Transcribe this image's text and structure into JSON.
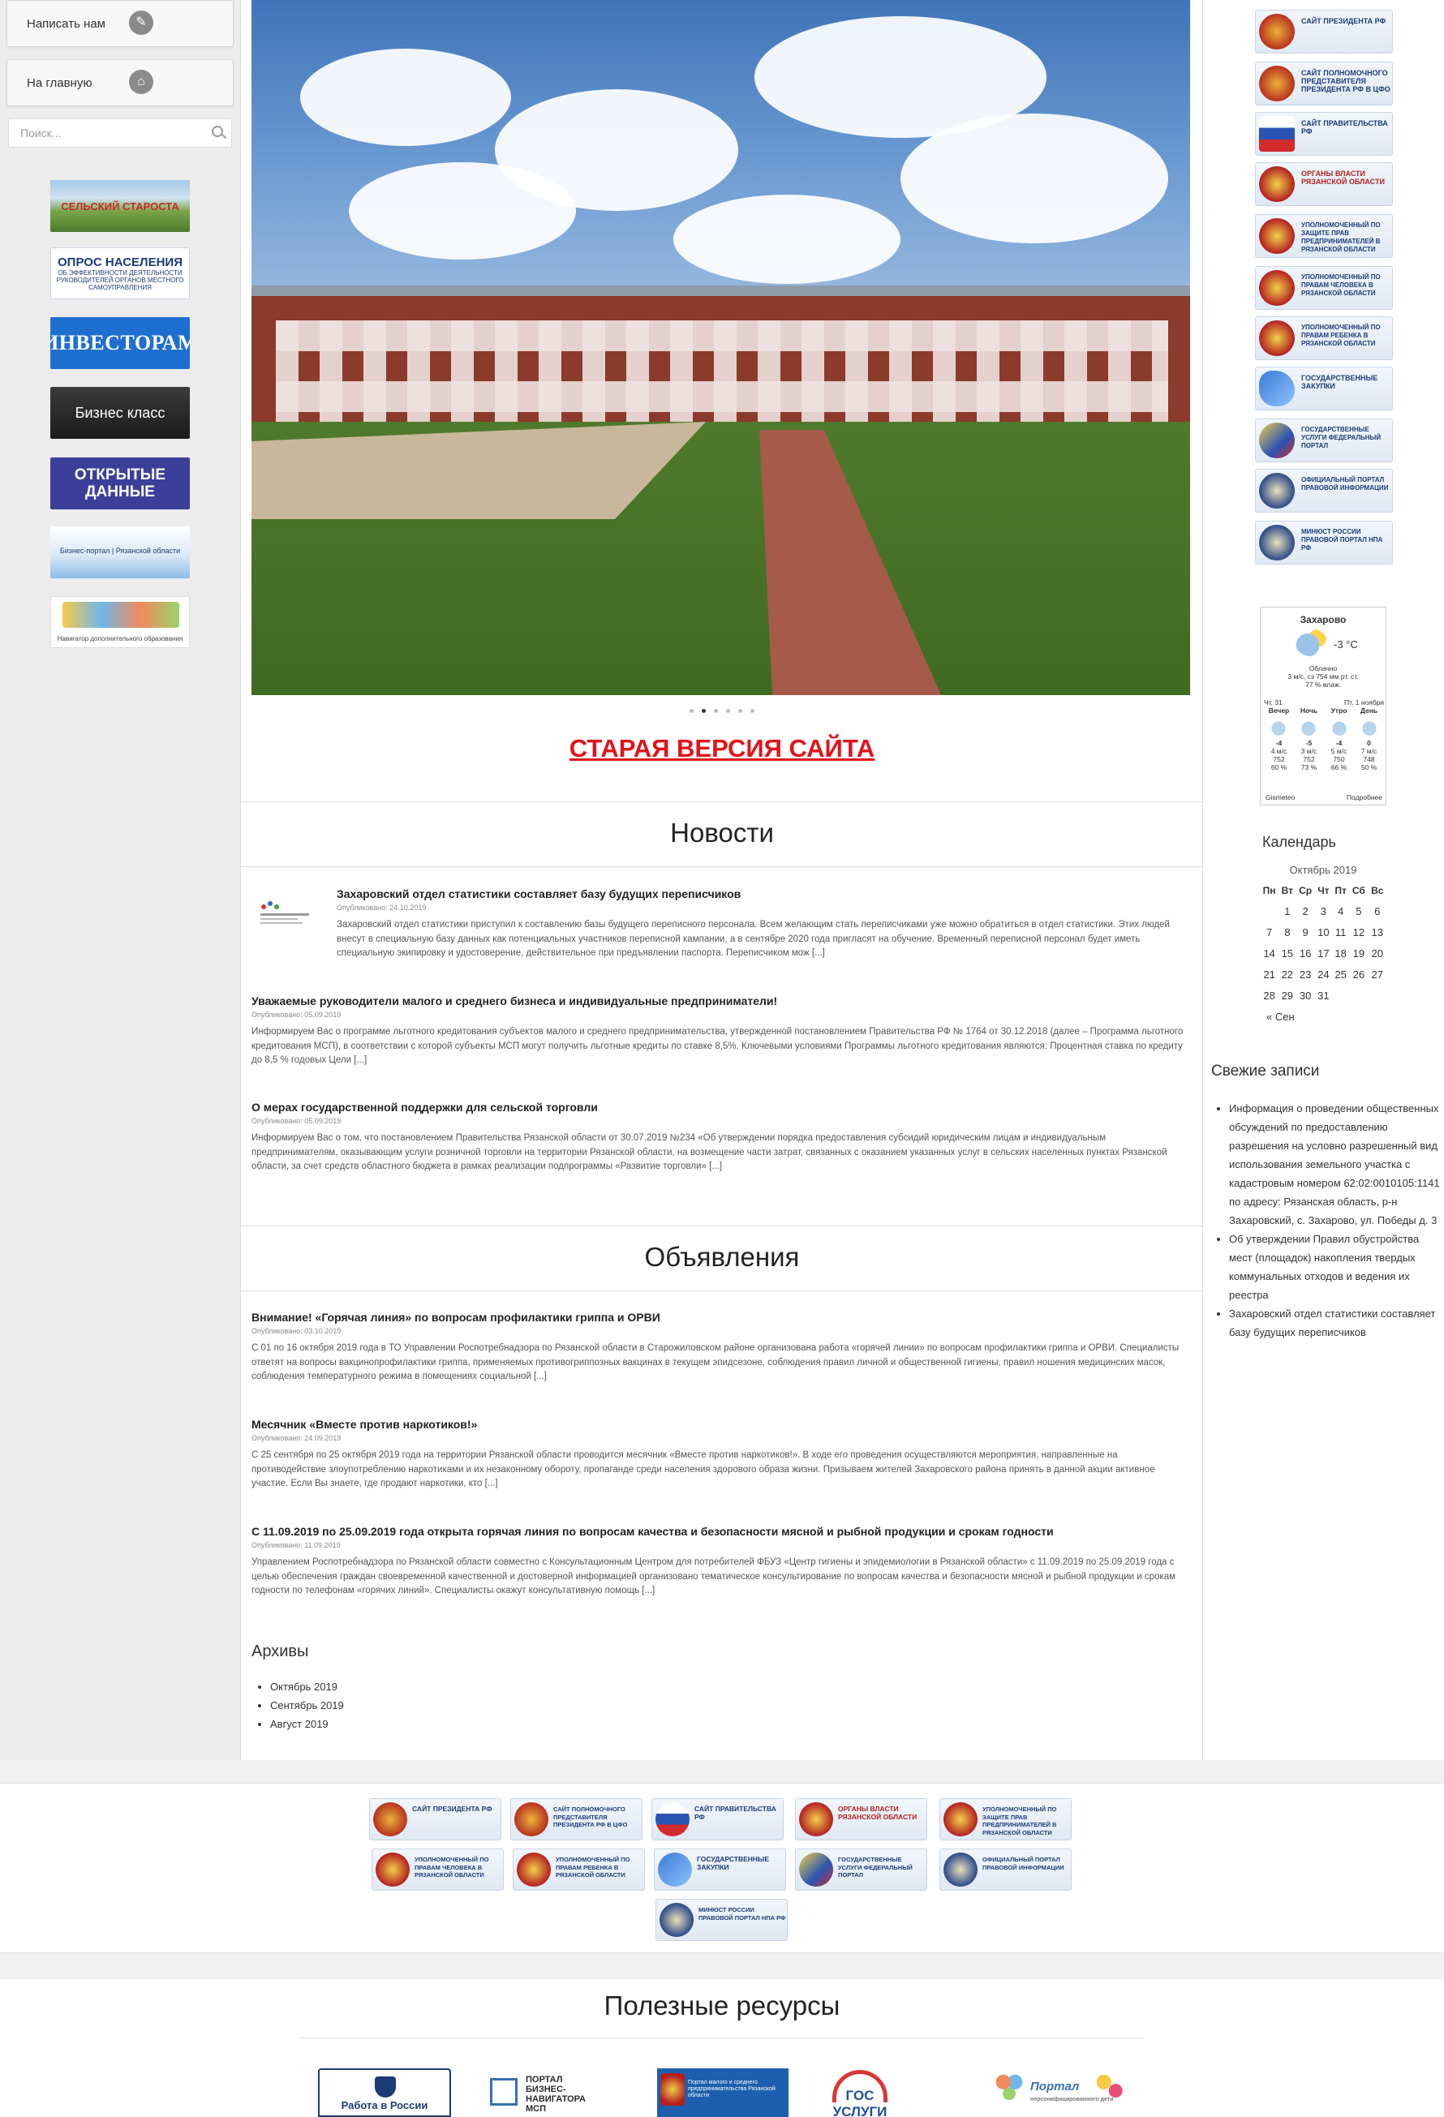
{
  "left_sidebar": {
    "write_us": "Написать нам",
    "home": "На главную",
    "search_placeholder": "Поиск...",
    "banners": {
      "selskiy": "СЕЛЬСКИЙ СТАРОСТА",
      "opros_title": "ОПРОС НАСЕЛЕНИЯ",
      "opros_sub": "ОБ ЭФФЕКТИВНОСТИ ДЕЯТЕЛЬНОСТИ РУКОВОДИТЕЛЕЙ ОРГАНОВ МЕСТНОГО САМОУПРАВЛЕНИЯ",
      "investoram": "ИНВЕСТОРАМ",
      "biznes": "Бизнес класс",
      "open_data": "ОТКРЫТЫЕ ДАННЫЕ",
      "portal": "Бизнес-портал | Рязанской области",
      "navigator": "Навигатор дополнительного образования"
    },
    "icons": {
      "write": "pencil-icon",
      "home": "home-icon",
      "search": "search-icon"
    }
  },
  "hero": {
    "slides": 6,
    "active_slide": 2,
    "old_site_link": "СТАРАЯ ВЕРСИЯ САЙТА"
  },
  "news": {
    "title": "Новости",
    "items": [
      {
        "title": "Захаровский отдел статистики составляет базу будущих переписчиков",
        "date": "Опубликовано: 24.10.2019",
        "text": "Захаровский отдел статистики приступил к составлению базы будущего переписного персонала. Всем желающим стать переписчиками уже можно обратиться в отдел статистики. Этих людей внесут в специальную базу данных как потенциальных участников переписной кампании, а в сентябре 2020 года пригласят на обучение. Временный переписной персонал будет иметь специальную экипировку и удостоверение, действительное при предъявлении паспорта. Переписчиком мож [...]"
      },
      {
        "title": "Уважаемые руководители малого и среднего бизнеса и индивидуальные предприниматели!",
        "date": "Опубликовано: 05.09.2019",
        "text": "Информируем Вас о программе льготного кредитования субъектов малого и среднего предпринимательства, утвержденной постановлением Правительства РФ № 1764 от 30.12.2018 (далее – Программа льготного кредитования МСП), в соответствии с которой субъекты МСП могут получить льготные кредиты по ставке 8,5%. Ключевыми условиями Программы льготного кредитования являются:   Процентная ставка по кредиту до 8,5 % годовых Цели [...]"
      },
      {
        "title": "О мерах государственной поддержки для сельской торговли",
        "date": "Опубликовано: 05.09.2019",
        "text": "Информируем Вас о том, что постановлением Правительства Рязанской области от 30.07.2019 №234 «Об утверждении порядка предоставления субсидий юридическим лицам и индивидуальным предпринимателям, оказывающим услуги розничной торговли на территории Рязанской области, на возмещение части затрат, связанных с оказанием указанных услуг в сельских населенных пунктах Рязанской области, за счет средств областного бюджета в рамках реализации подпрограммы «Развитие торговли» [...]"
      }
    ]
  },
  "announcements": {
    "title": "Объявления",
    "items": [
      {
        "title": "Внимание! «Горячая линия» по вопросам профилактики гриппа и ОРВИ",
        "date": "Опубликовано: 03.10.2019",
        "text": "С 01 по 16 октября 2019 года в ТО Управлении Роспотребнадзора по Рязанской области в Старожиловском районе организована работа «горячей линии» по вопросам профилактики гриппа и ОРВИ. Специалисты ответят на вопросы вакцинопрофилактики гриппа, применяемых противогриппозных вакцинах в текущем эпидсезоне, соблюдения правил личной и общественной гигиены, правил ношения медицинских масок, соблюдения температурного режима в помещениях социальной [...]"
      },
      {
        "title": "Месячник «Вместе против наркотиков!»",
        "date": "Опубликовано: 24.09.2019",
        "text": "С 25 сентября по 25 октября 2019 года на территории Рязанской области проводится месячник «Вместе против наркотиков!». В ходе его проведения осуществляются мероприятия, направленные на противодействие  злоупотреблению наркотиками  и  их  незаконному  обороту, пропаганде среди населения здорового образа жизни. Призываем жителей Захаровского района принять в данной акции активное участие. Если Вы знаете, где продают  наркотики, кто [...]"
      },
      {
        "title": "С 11.09.2019 по 25.09.2019 года открыта горячая линия по вопросам качества и безопасности мясной и рыбной продукции и срокам годности",
        "date": "Опубликовано: 11.09.2019",
        "text": "Управлением Роспотребнадзора по Рязанской области совместно с Консультационным Центром для потребителей ФБУЗ «Центр гигиены и эпидемиологии в Рязанской области»  с 11.09.2019 по 25.09.2019 года с целью обеспечения граждан своевременной качественной и достоверной информацией организовано тематическое консультирование по вопросам качества и безопасности мясной и рыбной  продукции и срокам годности по телефонам «горячих линий». Специалисты окажут консультативную помощь [...]"
      }
    ]
  },
  "archives": {
    "title": "Архивы",
    "items": [
      "Октябрь 2019",
      "Сентябрь 2019",
      "Август 2019"
    ]
  },
  "right_sidebar": {
    "links": [
      "Сайт Президента РФ",
      "Сайт полномочного представителя Президента РФ в ЦФО",
      "Сайт Правительства РФ",
      "Органы власти Рязанской области",
      "Уполномоченный по защите прав предпринимателей в Рязанской области",
      "Уполномоченный по правам человека в Рязанской области",
      "Уполномоченный по правам ребенка в Рязанской области",
      "Государственные закупки",
      "Государственные услуги федеральный портал",
      "Официальный портал правовой информации",
      "Минюст России Правовой портал НПА РФ"
    ],
    "weather": {
      "city": "Захарово",
      "temp": "-3 °C",
      "cond1": "Облачно",
      "cond2": "3 м/с, сз   754 мм рт. ст.",
      "cond3": "77 % влаж.",
      "day1": "Чт, 31",
      "day2": "Пт, 1 ноября",
      "periods": [
        "Вечер",
        "Ночь",
        "Утро",
        "День"
      ],
      "temps": [
        "-4",
        "-5",
        "-4",
        "0"
      ],
      "wind": [
        "4 м/с",
        "3 м/с",
        "5 м/с",
        "7 м/с"
      ],
      "pressure": [
        "752",
        "752",
        "750",
        "748"
      ],
      "humidity": [
        "60 %",
        "73 %",
        "66 %",
        "50 %"
      ],
      "brand": "Gismeteo",
      "more": "Подробнее"
    },
    "calendar": {
      "title": "Календарь",
      "caption": "Октябрь 2019",
      "days": [
        "Пн",
        "Вт",
        "Ср",
        "Чт",
        "Пт",
        "Сб",
        "Вс"
      ],
      "weeks": [
        [
          "",
          "1",
          "2",
          "3",
          "4",
          "5",
          "6"
        ],
        [
          "7",
          "8",
          "9",
          "10",
          "11",
          "12",
          "13"
        ],
        [
          "14",
          "15",
          "16",
          "17",
          "18",
          "19",
          "20"
        ],
        [
          "21",
          "22",
          "23",
          "24",
          "25",
          "26",
          "27"
        ],
        [
          "28",
          "29",
          "30",
          "31",
          "",
          "",
          ""
        ]
      ],
      "prev": "« Сен"
    },
    "recent": {
      "title": "Свежие записи",
      "items": [
        "Информация о проведении общественных обсуждений по предоставлению разрешения на условно разрешенный вид использования земельного участка с кадастровым номером 62:02:0010105:1141 по адресу: Рязанская область, р-н Захаровский, с. Захарово, ул. Победы д. 3",
        "Об утверждении Правил обустройства мест (площадок) накопления твердых коммунальных отходов и ведения их реестра",
        "Захаровский отдел статистики составляет базу будущих переписчиков"
      ]
    }
  },
  "footer_strip": {
    "links": [
      "Сайт Президента РФ",
      "Сайт полномочного представителя Президента РФ в ЦФО",
      "Сайт Правительства РФ",
      "Органы власти Рязанской области",
      "Уполномоченный по защите прав предпринимателей в Рязанской области",
      "Уполномоченный по правам человека в Рязанской области",
      "Уполномоченный по правам ребенка в Рязанской области",
      "Государственные закупки",
      "Государственные услуги федеральный портал",
      "Официальный портал правовой информации",
      "Минюст России Правовой портал НПА РФ"
    ]
  },
  "resources": {
    "title": "Полезные ресурсы",
    "items": [
      "Работа в России",
      "ПОРТАЛ БИЗНЕС-НАВИГАТОРА МСП",
      "Портал малого и среднего предпринимательства Рязанской области",
      "ГОС УСЛУГИ",
      "Портал",
      "персонифицированного дети"
    ]
  }
}
